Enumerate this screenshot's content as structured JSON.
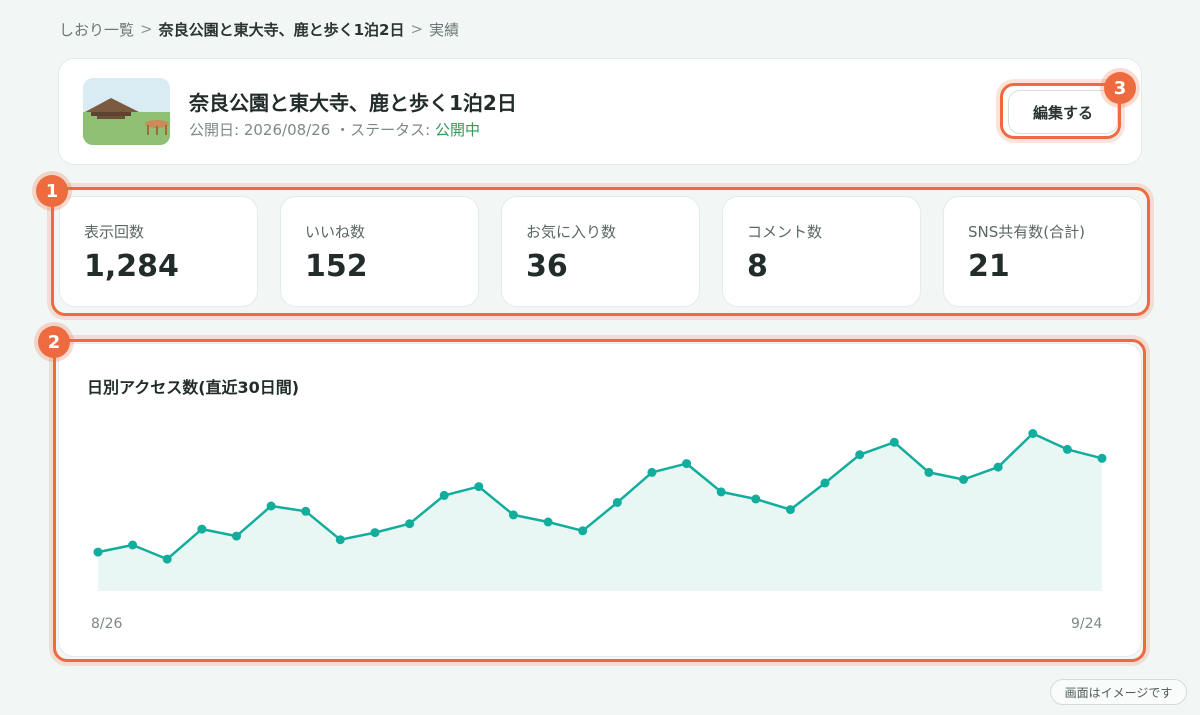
{
  "breadcrumb": {
    "root": "しおり一覧",
    "separator": ">",
    "plan": "奈良公園と東大寺、鹿と歩く1泊2日",
    "current": "実績"
  },
  "header": {
    "title": "奈良公園と東大寺、鹿と歩く1泊2日",
    "published_label": "公開日:",
    "published_date": "2026/08/26",
    "dot": "・",
    "status_label": "ステータス:",
    "status_value": "公開中",
    "status_color": "#2f9b55",
    "edit_label": "編集する"
  },
  "callouts": [
    "1",
    "2",
    "3"
  ],
  "stats": [
    {
      "label": "表示回数",
      "value": "1,284"
    },
    {
      "label": "いいね数",
      "value": "152"
    },
    {
      "label": "お気に入り数",
      "value": "36"
    },
    {
      "label": "コメント数",
      "value": "8"
    },
    {
      "label": "SNS共有数(合計)",
      "value": "21"
    }
  ],
  "chart_data": {
    "type": "area",
    "title": "日別アクセス数(直近30日間)",
    "x_start_label": "8/26",
    "x_end_label": "9/24",
    "values": [
      22,
      26,
      18,
      35,
      31,
      48,
      45,
      29,
      33,
      38,
      54,
      59,
      43,
      39,
      34,
      50,
      67,
      72,
      56,
      52,
      46,
      61,
      77,
      84,
      67,
      63,
      70,
      89,
      80,
      75
    ],
    "ylim": [
      0,
      100
    ],
    "line_color": "#12ad9c",
    "fill_color": "#e8f6f4",
    "grid": false,
    "legend": "none"
  },
  "disclaimer": "画面はイメージです",
  "colors": {
    "accent": "#ee6a3f",
    "background": "#f2f7f6"
  }
}
